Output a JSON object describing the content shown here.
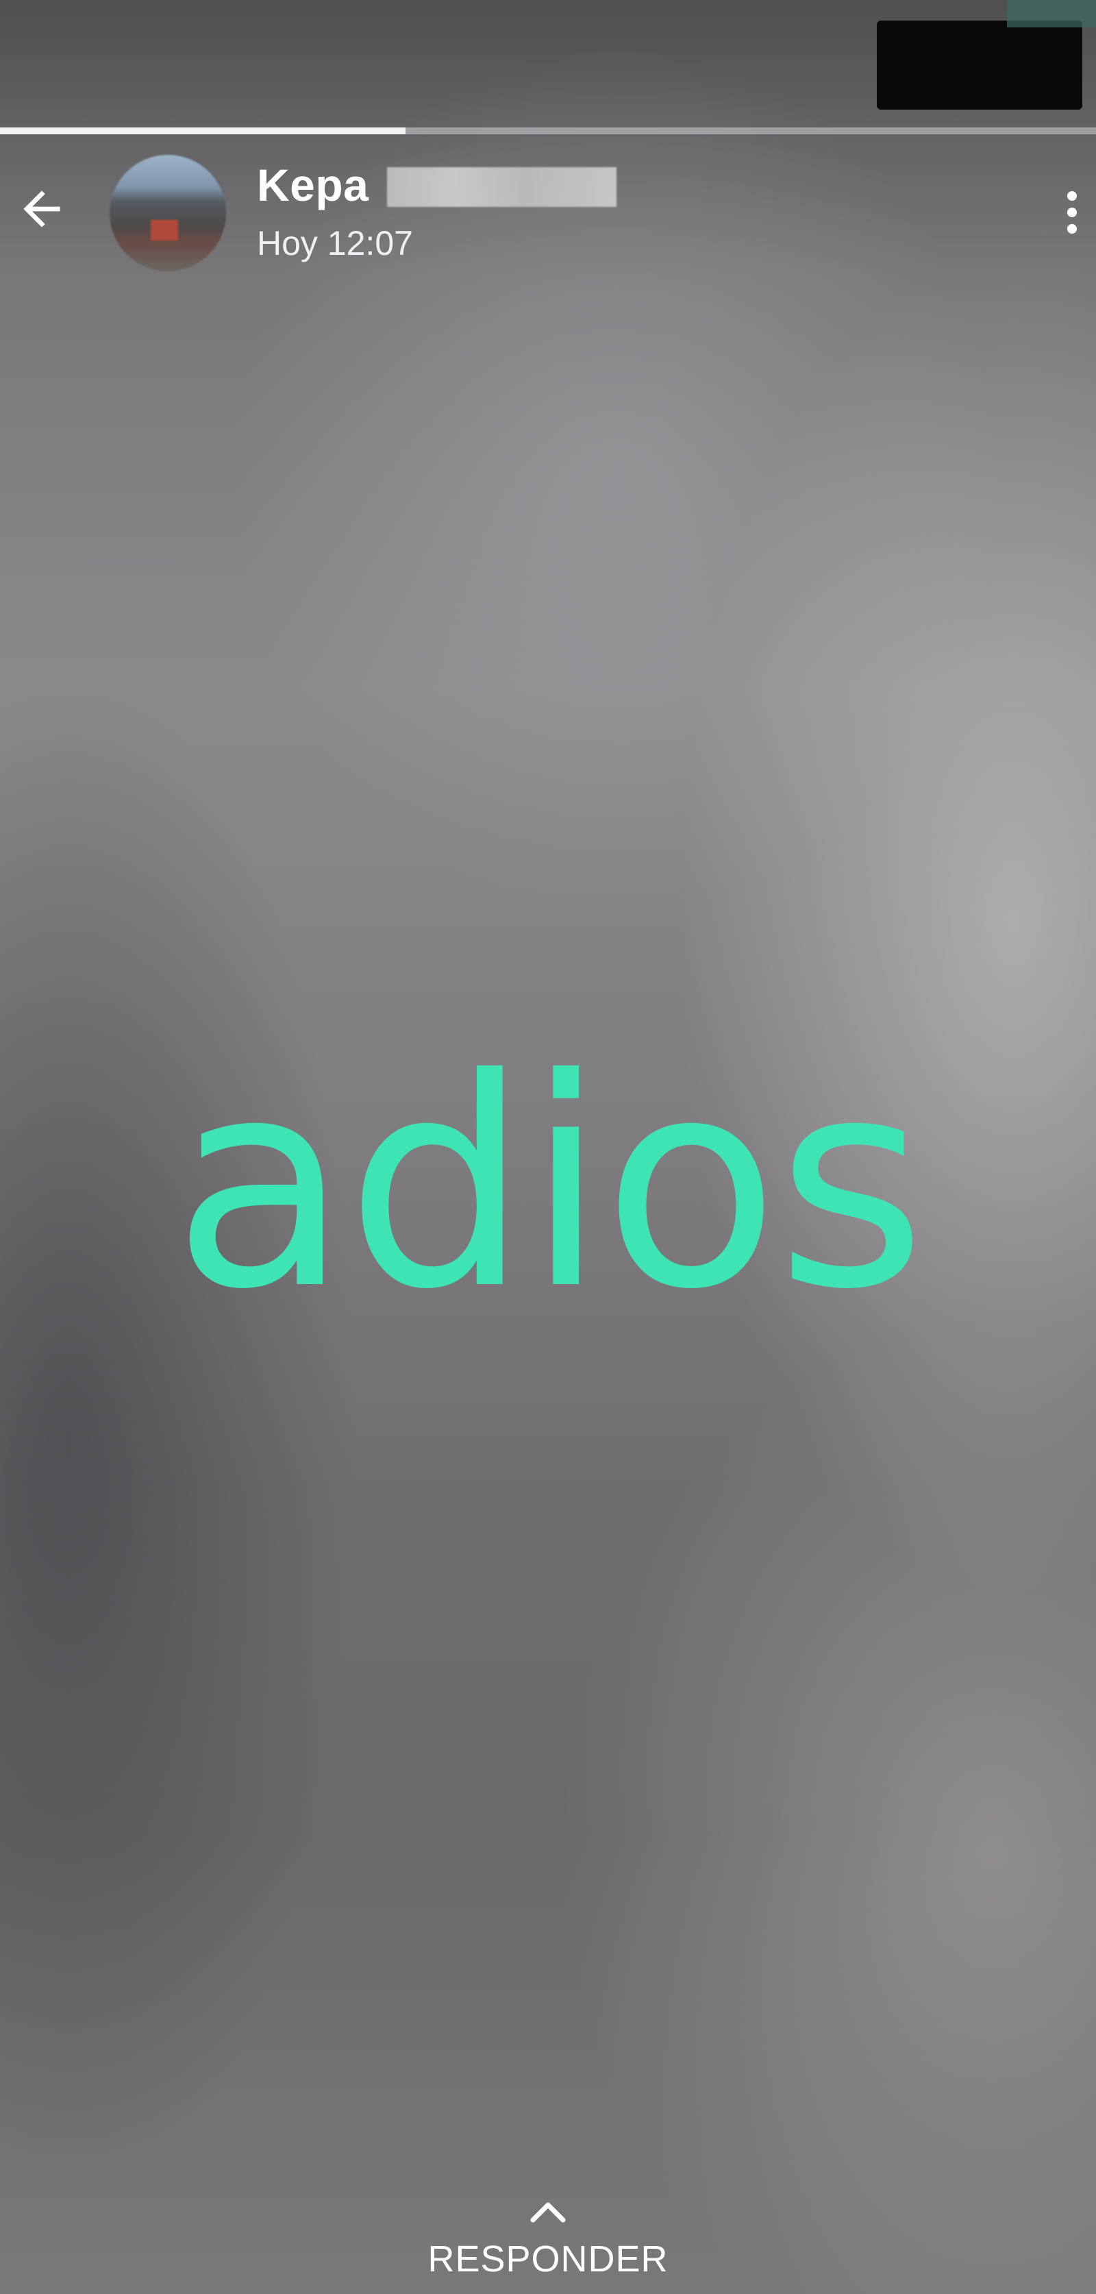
{
  "status_bar": {
    "redacted": true
  },
  "story": {
    "progress": 0.37,
    "text": "adios",
    "text_color": "#3fe4b5"
  },
  "header": {
    "back_icon": "arrow-left-icon",
    "contact_name": "Kepa",
    "timestamp": "Hoy 12:07",
    "more_icon": "more-vertical-icon"
  },
  "reply": {
    "icon": "chevron-up-icon",
    "label": "RESPONDER"
  }
}
